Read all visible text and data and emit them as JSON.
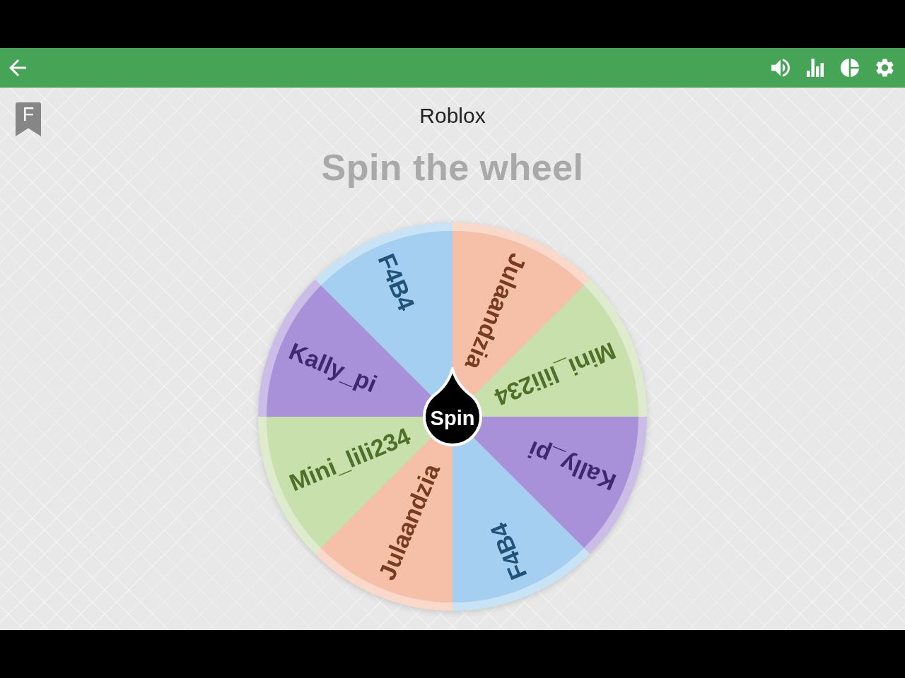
{
  "bookmark": {
    "letter": "F"
  },
  "title": "Roblox",
  "heading": "Spin the wheel",
  "wheel": {
    "segments": [
      {
        "label": "Julaandzia",
        "color": "#f6bfa8"
      },
      {
        "label": "Mini_lili234",
        "color": "#c8e0ab"
      },
      {
        "label": "Kally_pi",
        "color": "#a891d8"
      },
      {
        "label": "F4B4",
        "color": "#a4cff0"
      },
      {
        "label": "Julaandzia",
        "color": "#f6bfa8"
      },
      {
        "label": "Mini_lili234",
        "color": "#c8e0ab"
      },
      {
        "label": "Kally_pi",
        "color": "#a891d8"
      },
      {
        "label": "F4B4",
        "color": "#a4cff0"
      }
    ],
    "button": "Spin"
  }
}
